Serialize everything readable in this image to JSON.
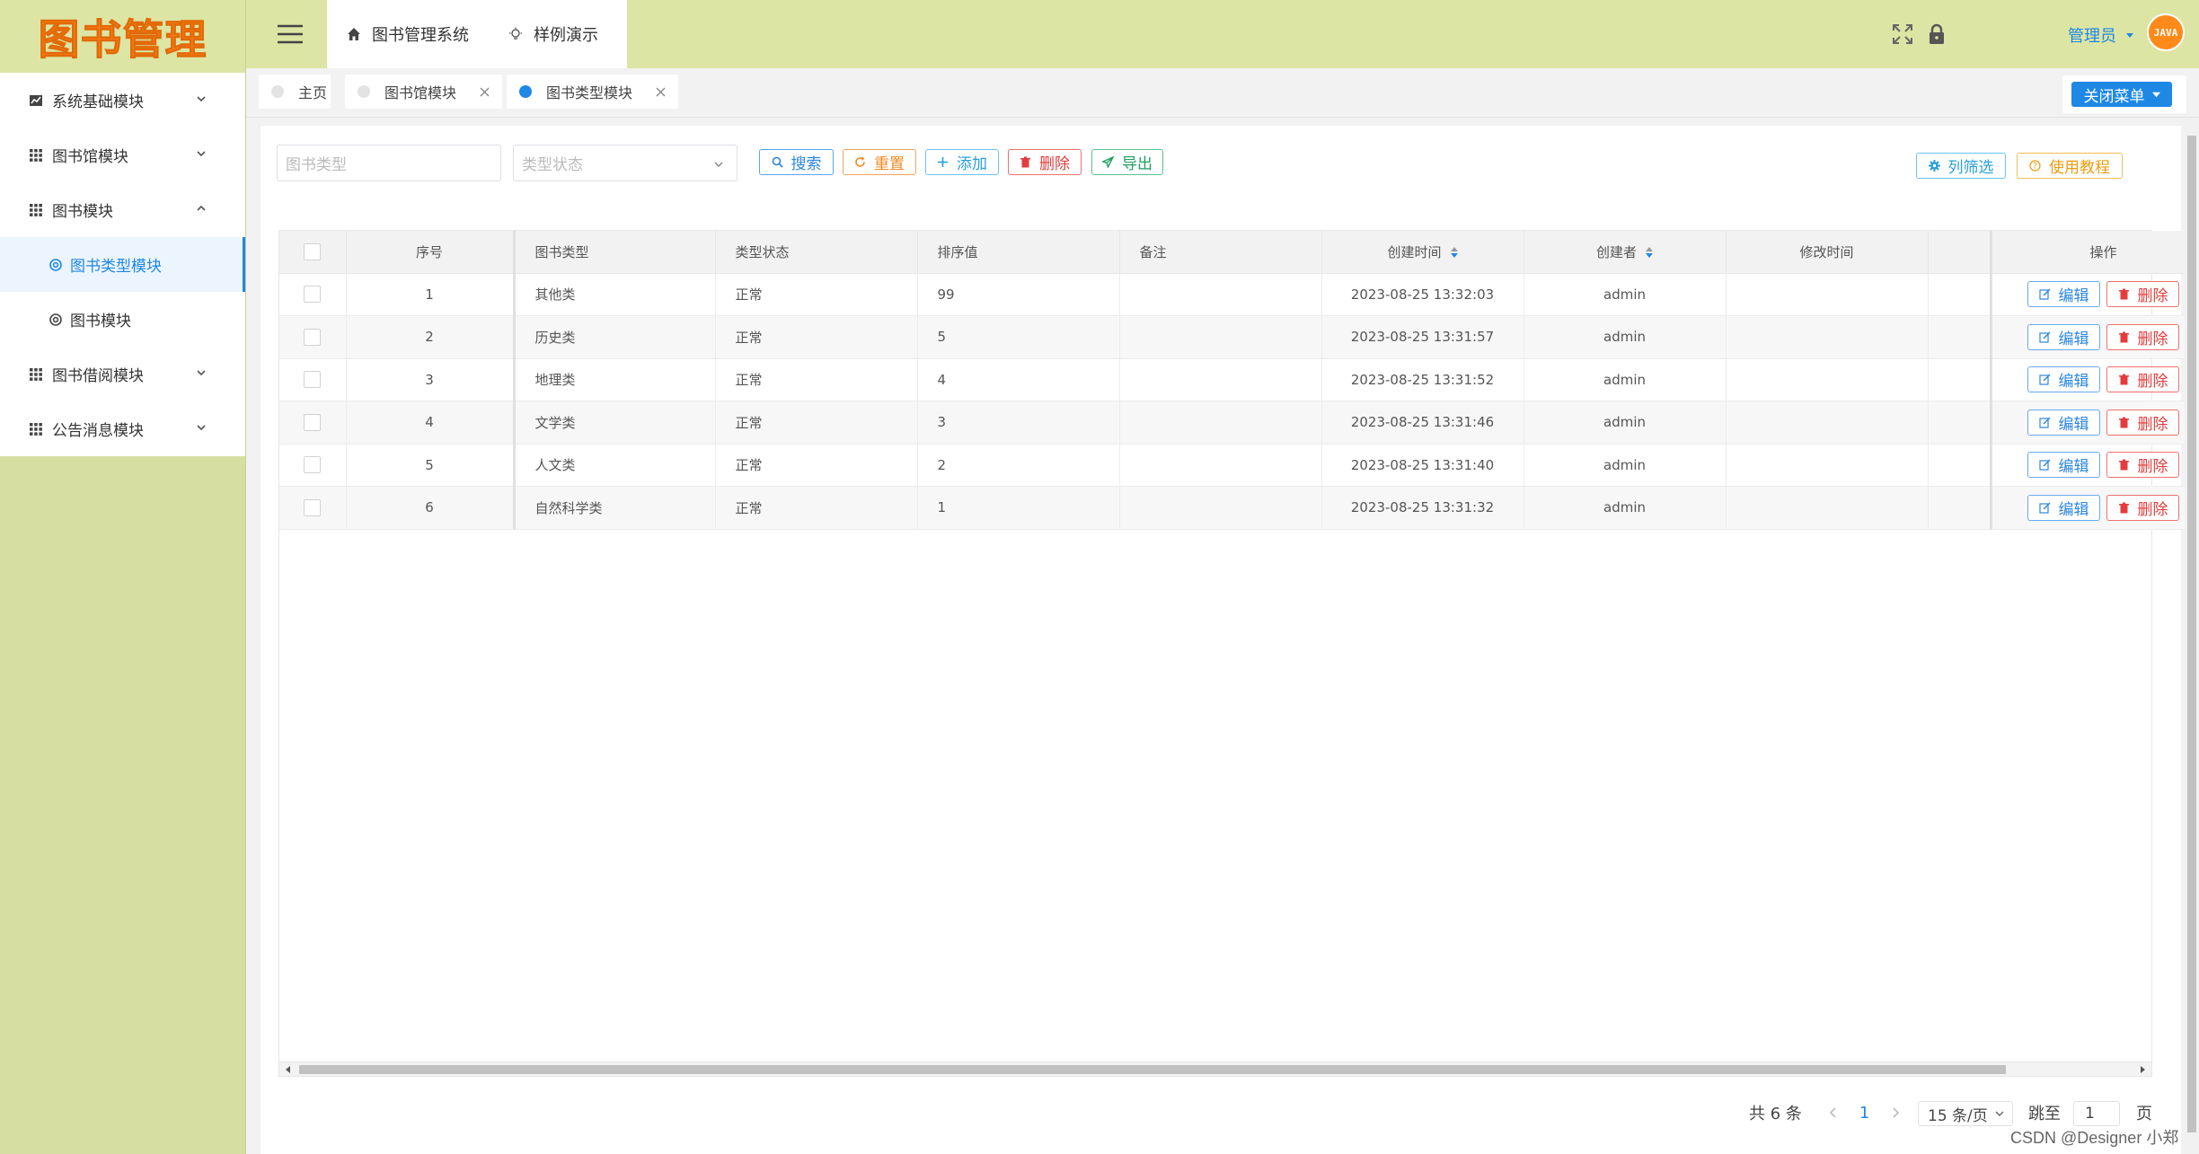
{
  "app": {
    "logo_text": "图书管理"
  },
  "sidebar": {
    "items": [
      {
        "label": "系统基础模块",
        "icon": "chart-icon",
        "expanded": false
      },
      {
        "label": "图书馆模块",
        "icon": "grid-icon",
        "expanded": false
      },
      {
        "label": "图书模块",
        "icon": "grid-icon",
        "expanded": true
      },
      {
        "label": "图书类型模块",
        "icon": "settings-icon",
        "sub": true,
        "active": true
      },
      {
        "label": "图书模块",
        "icon": "settings-icon",
        "sub": true
      },
      {
        "label": "图书借阅模块",
        "icon": "grid-icon",
        "expanded": false
      },
      {
        "label": "公告消息模块",
        "icon": "grid-icon",
        "expanded": false
      }
    ]
  },
  "header": {
    "tabs": [
      {
        "label": "图书管理系统",
        "icon": "home-icon"
      },
      {
        "label": "样例演示",
        "icon": "bulb-icon"
      }
    ],
    "user": "管理员",
    "avatar_text": "JAVA"
  },
  "page_tabs": [
    {
      "label": "主页"
    },
    {
      "label": "图书馆模块"
    },
    {
      "label": "图书类型模块",
      "active": true
    }
  ],
  "close_menu_label": "关闭菜单",
  "filters": {
    "type_placeholder": "图书类型",
    "status_placeholder": "类型状态"
  },
  "toolbar": {
    "search": "搜索",
    "reset": "重置",
    "add": "添加",
    "delete": "删除",
    "export": "导出",
    "column_filter": "列筛选",
    "tutorial": "使用教程"
  },
  "table": {
    "headers": {
      "index": "序号",
      "type": "图书类型",
      "status": "类型状态",
      "sort": "排序值",
      "remark": "备注",
      "created": "创建时间",
      "creator": "创建者",
      "modified": "修改时间",
      "actions": "操作"
    },
    "edit_label": "编辑",
    "delete_label": "删除",
    "rows": [
      {
        "index": "1",
        "type": "其他类",
        "status": "正常",
        "sort": "99",
        "remark": "",
        "created": "2023-08-25 13:32:03",
        "creator": "admin",
        "modified": ""
      },
      {
        "index": "2",
        "type": "历史类",
        "status": "正常",
        "sort": "5",
        "remark": "",
        "created": "2023-08-25 13:31:57",
        "creator": "admin",
        "modified": ""
      },
      {
        "index": "3",
        "type": "地理类",
        "status": "正常",
        "sort": "4",
        "remark": "",
        "created": "2023-08-25 13:31:52",
        "creator": "admin",
        "modified": ""
      },
      {
        "index": "4",
        "type": "文学类",
        "status": "正常",
        "sort": "3",
        "remark": "",
        "created": "2023-08-25 13:31:46",
        "creator": "admin",
        "modified": ""
      },
      {
        "index": "5",
        "type": "人文类",
        "status": "正常",
        "sort": "2",
        "remark": "",
        "created": "2023-08-25 13:31:40",
        "creator": "admin",
        "modified": ""
      },
      {
        "index": "6",
        "type": "自然科学类",
        "status": "正常",
        "sort": "1",
        "remark": "",
        "created": "2023-08-25 13:31:32",
        "creator": "admin",
        "modified": ""
      }
    ]
  },
  "pagination": {
    "total": "共 6 条",
    "current_page": "1",
    "page_size": "15 条/页",
    "jump_label": "跳至",
    "jump_value": "1",
    "page_suffix": "页"
  },
  "watermark": "CSDN @Designer 小郑",
  "colors": {
    "sidebar_bg": "#d6dea1",
    "header_bg": "#dde5a4",
    "accent": "#1e88e5",
    "logo": "#ff7f17"
  }
}
